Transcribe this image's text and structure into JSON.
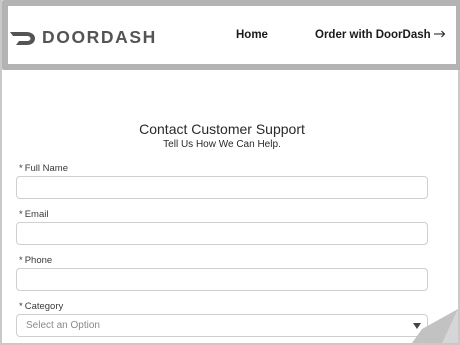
{
  "header": {
    "logo_text": "DOORDASH",
    "nav_home": "Home",
    "nav_order": "Order with DoorDash",
    "logo_icon": "doordash-chevron-icon",
    "arrow_icon": "arrow-right-icon"
  },
  "form": {
    "title": "Contact Customer Support",
    "subtitle": "Tell Us How We Can Help.",
    "required_mark": "*",
    "fields": {
      "full_name": {
        "label": "Full Name",
        "value": ""
      },
      "email": {
        "label": "Email",
        "value": ""
      },
      "phone": {
        "label": "Phone",
        "value": ""
      },
      "category": {
        "label": "Category",
        "selected": "Select an Option"
      }
    }
  },
  "colors": {
    "header_border": "#b3b3b3",
    "logo_gray": "#545454",
    "input_border": "#cfcfcf"
  }
}
